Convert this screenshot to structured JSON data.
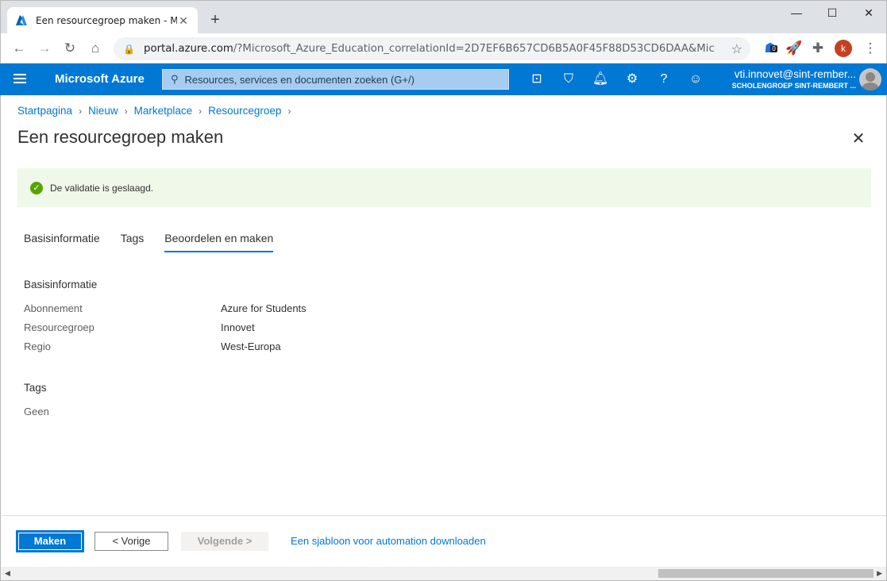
{
  "browser": {
    "tab_title": "Een resourcegroep maken - Micr",
    "url_domain": "portal.azure.com",
    "url_rest": "/?Microsoft_Azure_Education_correlationId=2D7EF6B657CD6B5A0F45F88D53CD6DAA&Microsoft_A...",
    "profile_initial": "k",
    "extension_badge": "0"
  },
  "azure": {
    "brand": "Microsoft Azure",
    "search_placeholder": "Resources, services en documenten zoeken (G+/)",
    "user_name": "vti.innovet@sint-rember...",
    "user_org": "SCHOLENGROEP SINT-REMBERT ..."
  },
  "breadcrumb": [
    "Startpagina",
    "Nieuw",
    "Marketplace",
    "Resourcegroep"
  ],
  "page": {
    "title": "Een resourcegroep maken",
    "validation_message": "De validatie is geslaagd."
  },
  "tabs": [
    "Basisinformatie",
    "Tags",
    "Beoordelen en maken"
  ],
  "summary": {
    "basics_heading": "Basisinformatie",
    "rows": [
      {
        "label": "Abonnement",
        "value": "Azure for Students"
      },
      {
        "label": "Resourcegroep",
        "value": "Innovet"
      },
      {
        "label": "Regio",
        "value": "West-Europa"
      }
    ],
    "tags_heading": "Tags",
    "tags_value": "Geen"
  },
  "footer": {
    "create": "Maken",
    "previous": "< Vorige",
    "next": "Volgende >",
    "download_link": "Een sjabloon voor automation downloaden"
  }
}
